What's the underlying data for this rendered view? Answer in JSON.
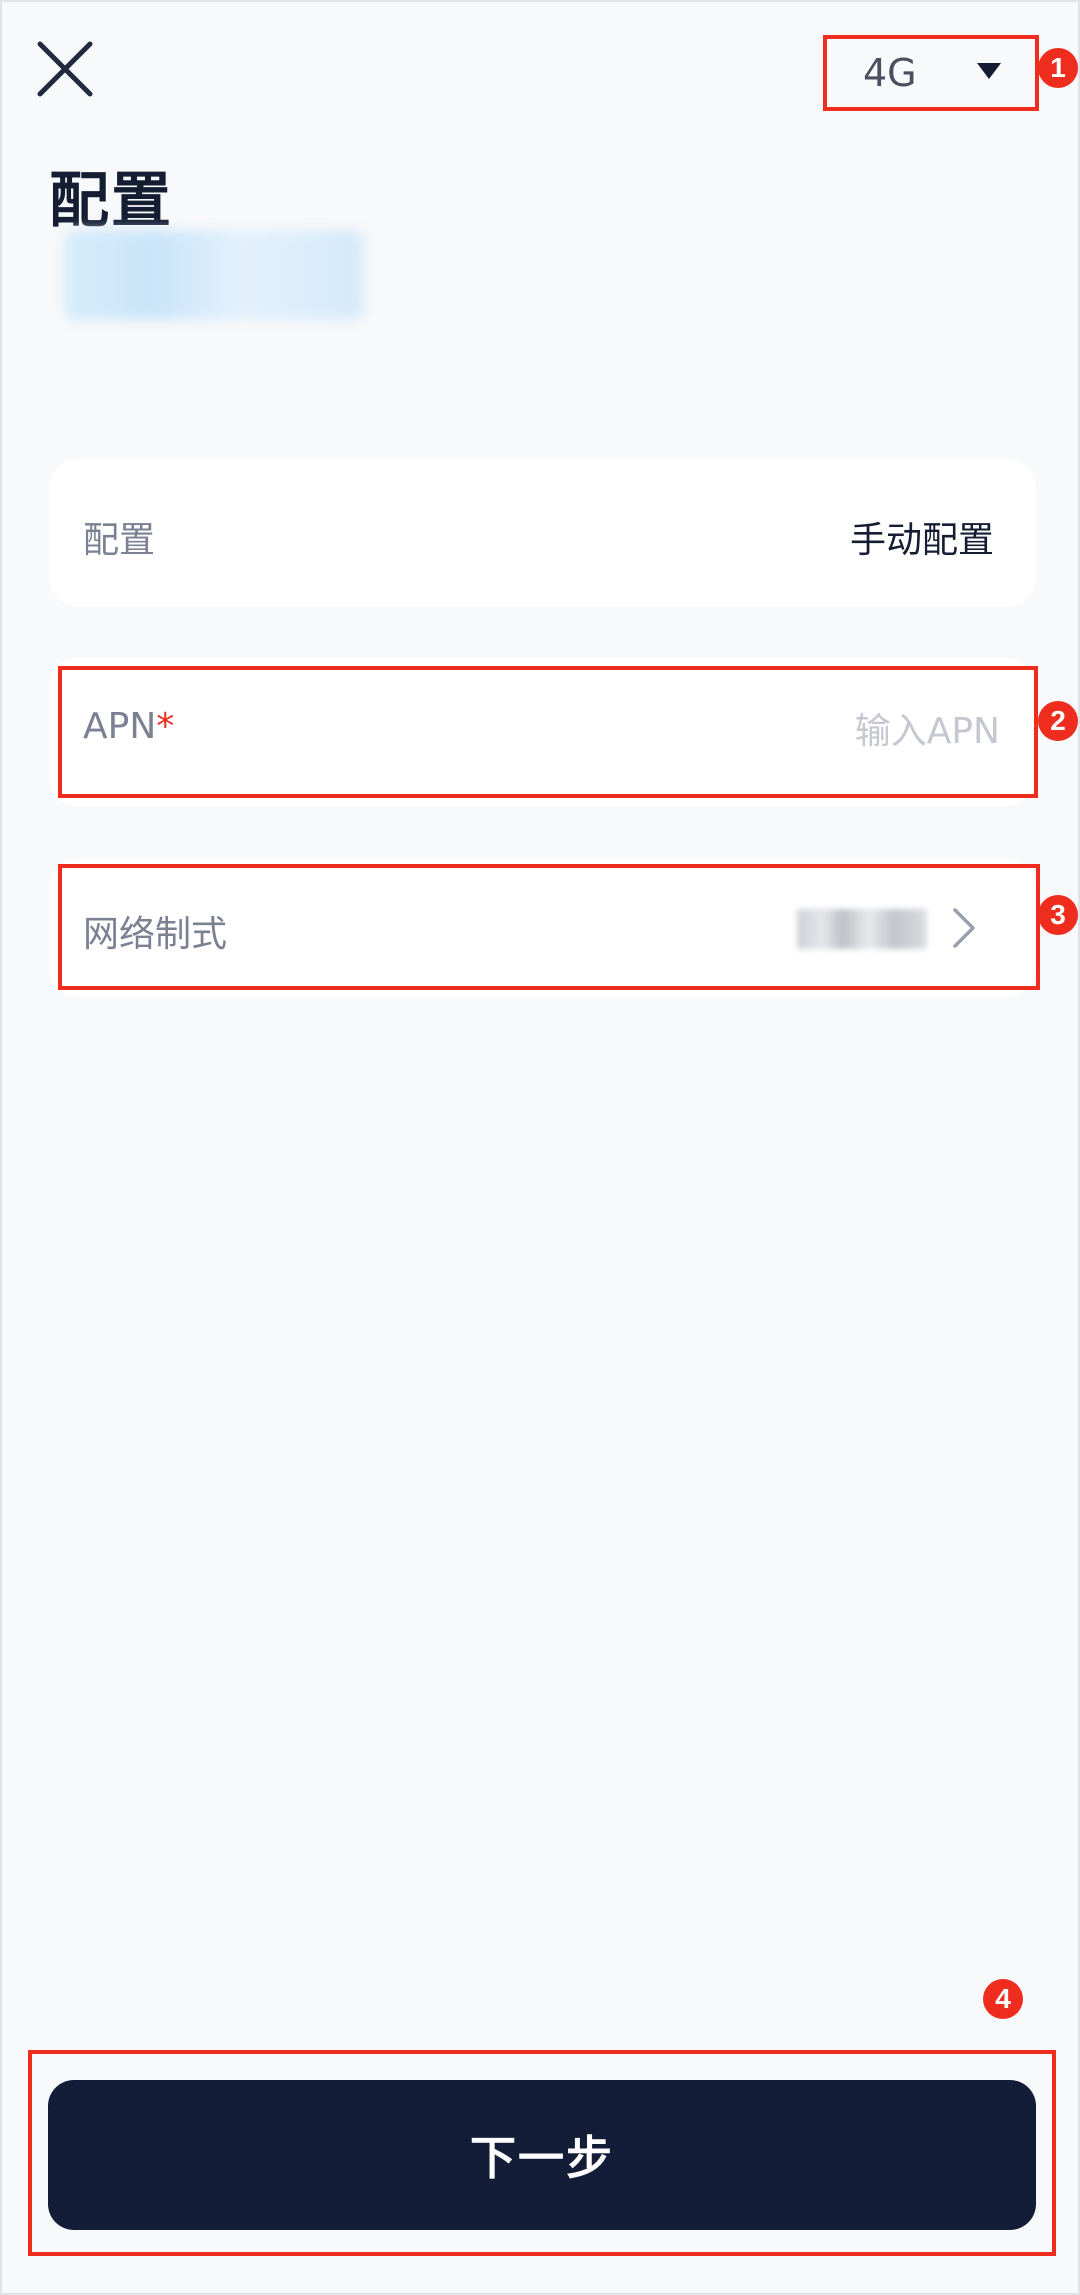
{
  "header": {
    "close_icon": "close-icon",
    "network_type": {
      "selected": "4G",
      "icon": "caret-down-icon"
    }
  },
  "page": {
    "title": "配置"
  },
  "config_row": {
    "label": "配置",
    "value": "手动配置"
  },
  "apn_row": {
    "label": "APN",
    "required_mark": "*",
    "value": "",
    "placeholder": "输入APN"
  },
  "network_mode_row": {
    "label": "网络制式",
    "chevron_icon": "chevron-right-icon"
  },
  "footer": {
    "next_label": "下一步"
  },
  "annotations": {
    "color": "#ef2d1f",
    "markers": [
      "1",
      "2",
      "3",
      "4"
    ]
  },
  "colors": {
    "background": "#f8f9fa",
    "card": "#ffffff",
    "primary_dark": "#131d38",
    "label_gray": "#7b8193",
    "required_red": "#ef2d1f",
    "placeholder_gray": "#c5c8d0"
  }
}
